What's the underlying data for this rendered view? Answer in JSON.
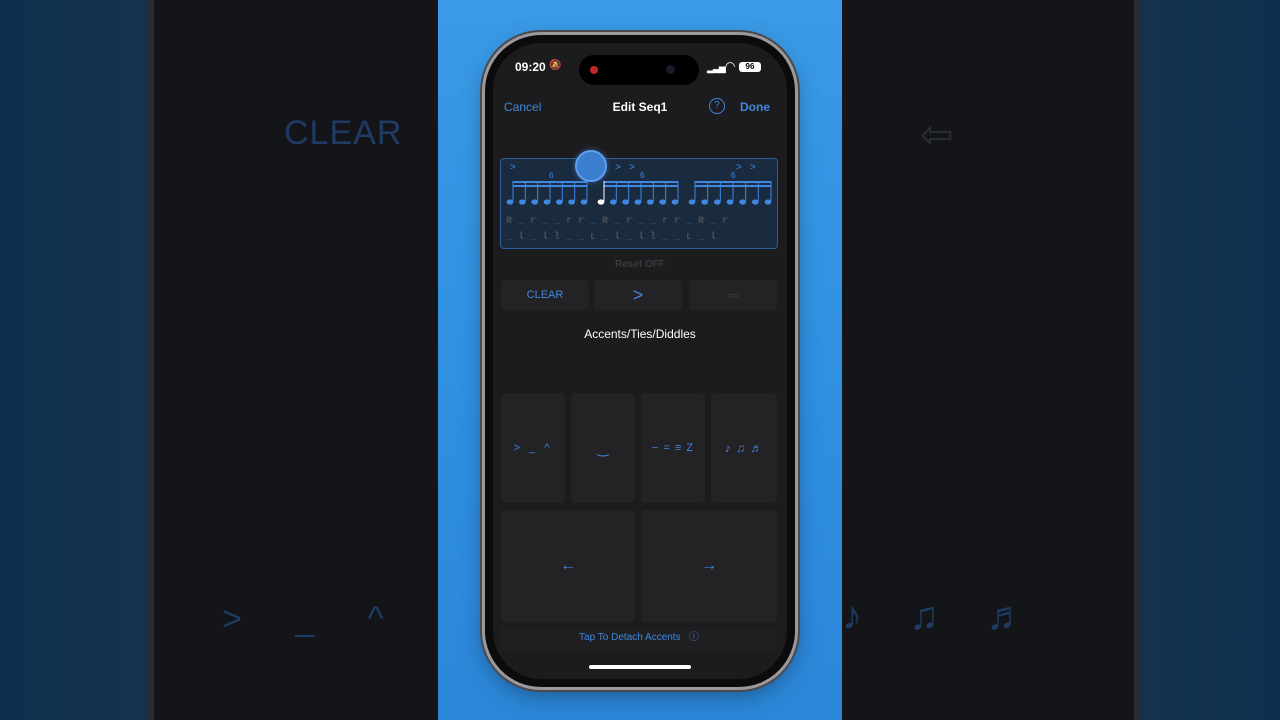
{
  "status_bar": {
    "time": "09:20",
    "mute_icon": "bell-slash-icon",
    "battery": "96"
  },
  "nav": {
    "cancel": "Cancel",
    "title": "Edit Seq1",
    "help": "?",
    "done": "Done"
  },
  "notation": {
    "accent_marks": [
      ">",
      ">",
      ">",
      ">",
      ">"
    ],
    "tuplet": "6",
    "sticking_row1": "R _ r _ _ r r _ R _ r _ _ r r _ R _ r",
    "sticking_row2": "_ l _ l l _ _ L _ l _ l l _ _ L _ l"
  },
  "reset_label": "Reset OFF",
  "controls": {
    "clear": "CLEAR",
    "accent": ">",
    "back": "⇦"
  },
  "section_title": "Accents/Ties/Diddles",
  "tiles": {
    "accents": "> _ ^",
    "tie": "‿",
    "diddles": "− = ≡ Z",
    "notes": "♪ ♫ ♬",
    "left_arrow": "←",
    "right_arrow": "→"
  },
  "detach": "Tap To Detach Accents",
  "colors": {
    "accent": "#3f87e0",
    "screen_bg": "#1c1c1e",
    "tile_bg": "#232326"
  }
}
